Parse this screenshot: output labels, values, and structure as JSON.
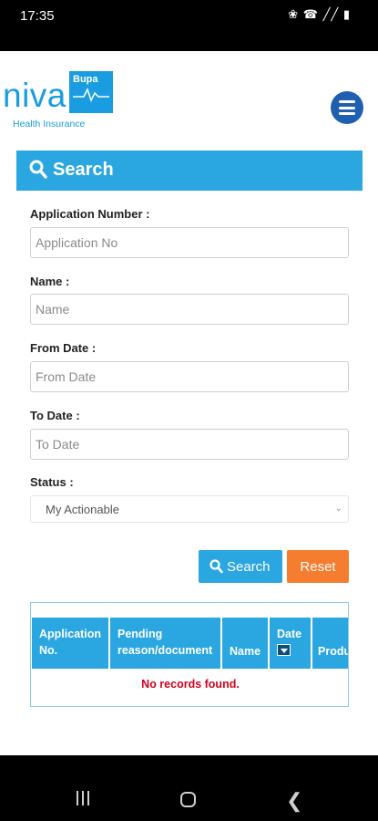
{
  "status_bar": {
    "time": "17:35",
    "icons": "❀ ☎ ╱╱ ▮"
  },
  "logo": {
    "brand": "niva",
    "partner": "Bupa",
    "tagline": "Health Insurance"
  },
  "search": {
    "title": "Search",
    "fields": [
      {
        "label": "Application Number :",
        "placeholder": "Application No"
      },
      {
        "label": "Name :",
        "placeholder": "Name"
      },
      {
        "label": "From Date :",
        "placeholder": "From Date"
      },
      {
        "label": "To Date :",
        "placeholder": "To Date"
      }
    ],
    "status": {
      "label": "Status :",
      "selected": "My Actionable"
    },
    "search_button": "Search",
    "reset_button": "Reset"
  },
  "results": {
    "columns": [
      "Application No.",
      "Pending reason/document",
      "Name",
      "Date",
      "Product"
    ],
    "empty_message": "No records found."
  },
  "colors": {
    "primary": "#2aa6e0",
    "reset": "#f47d30",
    "menu": "#1f5fb0",
    "error": "#d0021b"
  }
}
